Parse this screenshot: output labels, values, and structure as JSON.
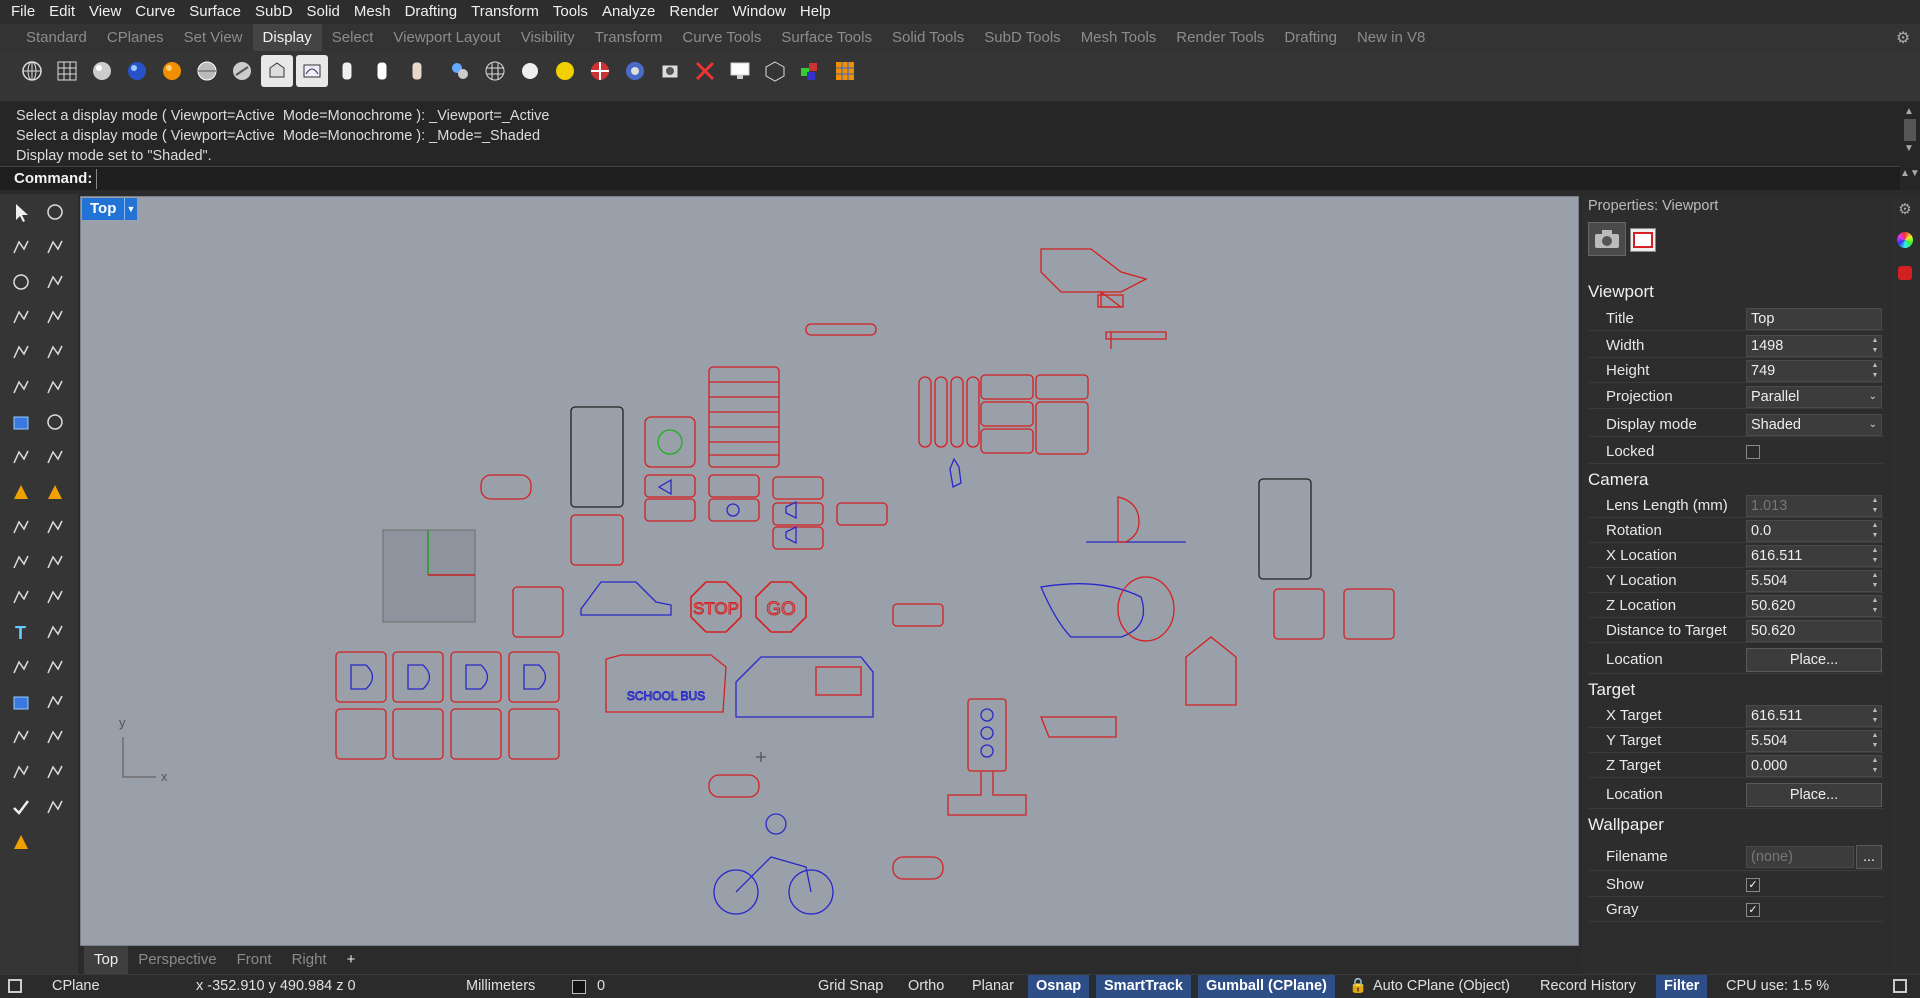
{
  "menu": [
    "File",
    "Edit",
    "View",
    "Curve",
    "Surface",
    "SubD",
    "Solid",
    "Mesh",
    "Drafting",
    "Transform",
    "Tools",
    "Analyze",
    "Render",
    "Window",
    "Help"
  ],
  "toolbar_tabs": [
    {
      "label": "Standard",
      "active": false
    },
    {
      "label": "CPlanes",
      "active": false
    },
    {
      "label": "Set View",
      "active": false
    },
    {
      "label": "Display",
      "active": true
    },
    {
      "label": "Select",
      "active": false
    },
    {
      "label": "Viewport Layout",
      "active": false
    },
    {
      "label": "Visibility",
      "active": false
    },
    {
      "label": "Transform",
      "active": false
    },
    {
      "label": "Curve Tools",
      "active": false
    },
    {
      "label": "Surface Tools",
      "active": false
    },
    {
      "label": "Solid Tools",
      "active": false
    },
    {
      "label": "SubD Tools",
      "active": false
    },
    {
      "label": "Mesh Tools",
      "active": false
    },
    {
      "label": "Render Tools",
      "active": false
    },
    {
      "label": "Drafting",
      "active": false
    },
    {
      "label": "New in V8",
      "active": false
    }
  ],
  "toolbar_icons": [
    "wireframe-icon",
    "grid-icon",
    "shaded-icon",
    "rendered-icon",
    "ghosted-icon",
    "xray-icon",
    "technical-icon",
    "monochrome-icon",
    "artistic-icon",
    "pen-icon",
    "arctic-icon",
    "raytraced-icon",
    "set-display-mode-icon",
    "mesh-display-icon",
    "sphere-icon",
    "light-icon",
    "cplane-icon",
    "environment-icon",
    "capture-icon",
    "no-shade-icon",
    "monitor-icon",
    "cube-icon",
    "objects-icon",
    "color-grid-icon"
  ],
  "command_history": [
    "Select a display mode ( Viewport=Active  Mode=Monochrome ): _Viewport=_Active",
    "Select a display mode ( Viewport=Active  Mode=Monochrome ): _Mode=_Shaded",
    "Display mode set to \"Shaded\"."
  ],
  "command": {
    "label": "Command:",
    "value": ""
  },
  "viewport": {
    "title": "Top",
    "axis_x": "x",
    "axis_y": "y",
    "sign_stop": "STOP",
    "sign_go": "GO",
    "bus_text": "SCHOOL BUS"
  },
  "viewport_tabs": [
    {
      "label": "Top",
      "active": true
    },
    {
      "label": "Perspective",
      "active": false
    },
    {
      "label": "Front",
      "active": false
    },
    {
      "label": "Right",
      "active": false
    },
    {
      "label": "+",
      "active": false
    }
  ],
  "properties": {
    "title": "Properties: Viewport",
    "sections": {
      "viewport": "Viewport",
      "camera": "Camera",
      "target": "Target",
      "wallpaper": "Wallpaper"
    },
    "viewport": {
      "title_label": "Title",
      "title_value": "Top",
      "width_label": "Width",
      "width_value": "1498",
      "height_label": "Height",
      "height_value": "749",
      "projection_label": "Projection",
      "projection_value": "Parallel",
      "display_label": "Display mode",
      "display_value": "Shaded",
      "locked_label": "Locked",
      "locked": false
    },
    "camera": {
      "lens_label": "Lens Length (mm)",
      "lens_value": "1.013",
      "rotation_label": "Rotation",
      "rotation_value": "0.0",
      "x_label": "X Location",
      "x_value": "616.511",
      "y_label": "Y Location",
      "y_value": "5.504",
      "z_label": "Z Location",
      "z_value": "50.620",
      "dist_label": "Distance to Target",
      "dist_value": "50.620",
      "location_label": "Location",
      "place_label": "Place..."
    },
    "target": {
      "x_label": "X Target",
      "x_value": "616.511",
      "y_label": "Y Target",
      "y_value": "5.504",
      "z_label": "Z Target",
      "z_value": "0.000",
      "location_label": "Location",
      "place_label": "Place..."
    },
    "wallpaper": {
      "filename_label": "Filename",
      "filename_value": "(none)",
      "browse_label": "...",
      "show_label": "Show",
      "show": true,
      "gray_label": "Gray",
      "gray": true
    }
  },
  "status": {
    "cplane": "CPlane",
    "coords": "x -352.910  y 490.984  z 0",
    "units": "Millimeters",
    "layer": "0",
    "grid_snap": "Grid Snap",
    "ortho": "Ortho",
    "planar": "Planar",
    "osnap": "Osnap",
    "smarttrack": "SmartTrack",
    "gumball": "Gumball (CPlane)",
    "auto_cplane": "Auto CPlane (Object)",
    "record_history": "Record History",
    "filter": "Filter",
    "cpu": "CPU use: 1.5 %"
  },
  "colors": {
    "accent": "#2173d6",
    "curve_red": "#d42020",
    "curve_blue": "#2828c8",
    "viewport_bg": "#9aa0aa"
  }
}
